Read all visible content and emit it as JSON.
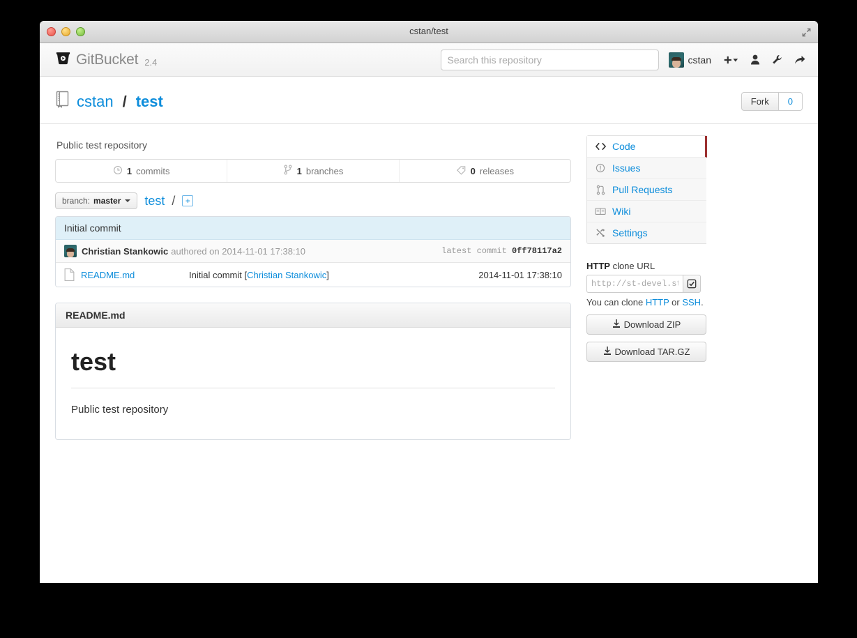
{
  "window": {
    "title": "cstan/test",
    "fullscreen_icon": "expand-diagonal-icon",
    "traffic_lights": [
      "close",
      "minimize",
      "zoom"
    ]
  },
  "header": {
    "brand": "GitBucket",
    "version": "2.4",
    "logo_icon": "gitbucket-bucket-icon",
    "search": {
      "placeholder": "Search this repository",
      "value": ""
    },
    "user": {
      "name": "cstan",
      "avatar": "user-avatar"
    },
    "icons": [
      {
        "name": "plus-dropdown-icon",
        "glyph": "+"
      },
      {
        "name": "user-icon",
        "glyph": "\u0001"
      },
      {
        "name": "wrench-icon",
        "glyph": "\u0001"
      },
      {
        "name": "sign-out-icon",
        "glyph": "\u0001"
      }
    ]
  },
  "repo": {
    "icon": "repository-book-icon",
    "owner": "cstan",
    "separator": "/",
    "name": "test",
    "description": "Public test repository",
    "fork": {
      "label": "Fork",
      "count": "0"
    }
  },
  "stats": [
    {
      "icon": "history-clock-icon",
      "count": "1",
      "label": "commits"
    },
    {
      "icon": "branch-icon",
      "count": "1",
      "label": "branches"
    },
    {
      "icon": "tag-icon",
      "count": "0",
      "label": "releases"
    }
  ],
  "branch_row": {
    "prefix": "branch:",
    "branch": "master",
    "crumb": "test",
    "crumb_sep": "/",
    "add_file_icon": "add-file-icon",
    "add_file_glyph": "+"
  },
  "commit": {
    "message": "Initial commit",
    "author": "Christian Stankowic",
    "meta": "authored on 2014-11-01 17:38:10",
    "latest_label": "latest commit",
    "hash": "0ff78117a2"
  },
  "files": [
    {
      "icon": "file-icon",
      "name": "README.md",
      "commit_prefix": "Initial commit [",
      "commit_author": "Christian Stankowic",
      "commit_suffix": "]",
      "date": "2014-11-01 17:38:10"
    }
  ],
  "readme": {
    "filename": "README.md",
    "heading": "test",
    "body": "Public test repository"
  },
  "sidebar": {
    "nav": [
      {
        "label": "Code",
        "icon": "code-brackets-icon",
        "active": true
      },
      {
        "label": "Issues",
        "icon": "issue-circle-icon",
        "active": false
      },
      {
        "label": "Pull Requests",
        "icon": "pull-request-icon",
        "active": false
      },
      {
        "label": "Wiki",
        "icon": "wiki-book-icon",
        "active": false
      },
      {
        "label": "Settings",
        "icon": "settings-tools-icon",
        "active": false
      }
    ],
    "clone": {
      "label_strong": "HTTP",
      "label_rest": " clone URL",
      "url_value": "http://st-devel.st",
      "copy_icon": "copy-clipboard-icon",
      "hint_prefix": "You can clone ",
      "hint_http": "HTTP",
      "hint_or": " or ",
      "hint_ssh": "SSH",
      "hint_suffix": "."
    },
    "downloads": [
      {
        "label": "Download ZIP",
        "icon": "download-icon"
      },
      {
        "label": "Download TAR.GZ",
        "icon": "download-icon"
      }
    ]
  },
  "colors": {
    "link": "#0d8ddb",
    "active_marker": "#9c3030",
    "commit_bar": "#dff0f8",
    "page_bg": "#000000"
  }
}
